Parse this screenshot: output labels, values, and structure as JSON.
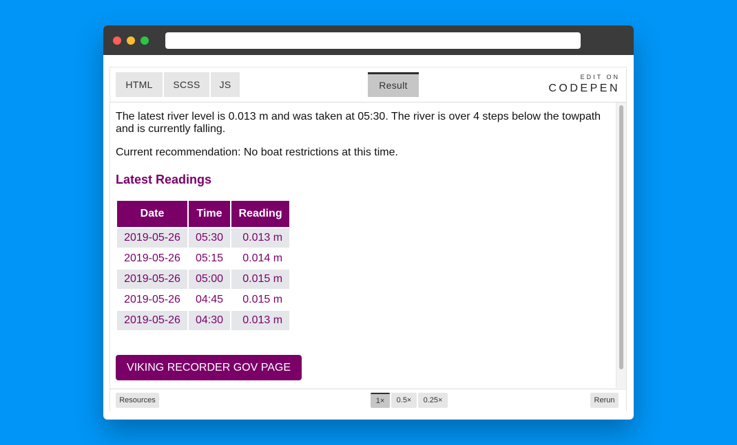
{
  "colors": {
    "background": "#0095f6",
    "accent": "#7a0068"
  },
  "browser": {
    "url": ""
  },
  "codepen": {
    "tabs": {
      "html": "HTML",
      "scss": "SCSS",
      "js": "JS",
      "result": "Result"
    },
    "edit_on": "EDIT ON",
    "brand": "CODEPEN",
    "footer": {
      "resources": "Resources",
      "zoom_1": "1×",
      "zoom_05": "0.5×",
      "zoom_025": "0.25×",
      "rerun": "Rerun"
    }
  },
  "page": {
    "status_text": "The latest river level is 0.013 m and was taken at 05:30. The river is over 4 steps below the towpath and is currently falling.",
    "recommendation": "Current recommendation: No boat restrictions at this time.",
    "readings_title": "Latest Readings",
    "table": {
      "headers": [
        "Date",
        "Time",
        "Reading"
      ],
      "rows": [
        [
          "2019-05-26",
          "05:30",
          "0.013 m"
        ],
        [
          "2019-05-26",
          "05:15",
          "0.014 m"
        ],
        [
          "2019-05-26",
          "05:00",
          "0.015 m"
        ],
        [
          "2019-05-26",
          "04:45",
          "0.015 m"
        ],
        [
          "2019-05-26",
          "04:30",
          "0.013 m"
        ]
      ]
    },
    "button_label": "VIKING RECORDER GOV PAGE"
  }
}
